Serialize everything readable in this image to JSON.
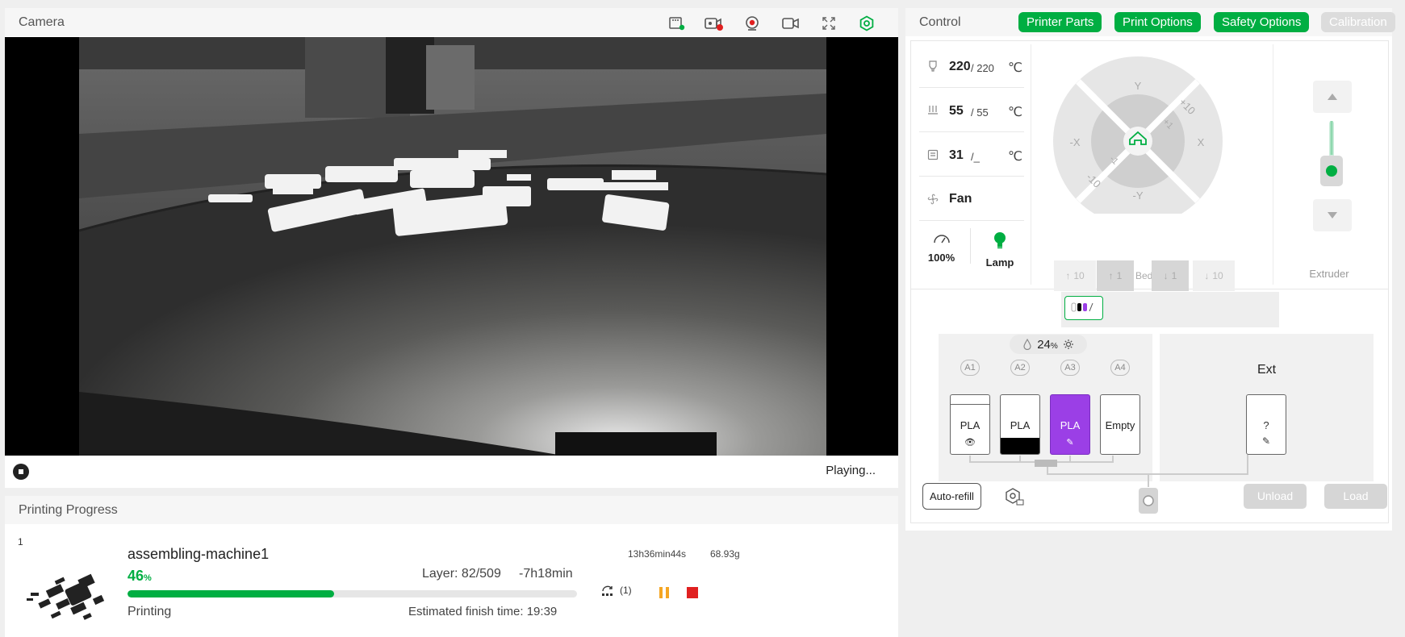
{
  "camera": {
    "title": "Camera",
    "status": "Playing...",
    "icons": [
      "sd-card-icon",
      "record-video-icon",
      "timelapse-icon",
      "camera-switch-icon",
      "fullscreen-icon",
      "settings-icon"
    ]
  },
  "progress": {
    "title": "Printing Progress",
    "job_number": "1",
    "job_name": "assembling-machine1",
    "percent": "46",
    "percent_unit": "%",
    "percent_value": 46,
    "layer": "Layer: 82/509",
    "remaining": "-7h18min",
    "status": "Printing",
    "finish_time": "Estimated finish time: 19:39",
    "duration": "13h36min44s",
    "weight": "68.93g",
    "skip_count": "(1)"
  },
  "control": {
    "title": "Control",
    "tabs": [
      {
        "label": "Printer Parts",
        "enabled": true
      },
      {
        "label": "Print Options",
        "enabled": true
      },
      {
        "label": "Safety Options",
        "enabled": true
      },
      {
        "label": "Calibration",
        "enabled": false
      }
    ],
    "nozzle": {
      "current": "220",
      "target": "/ 220",
      "unit": "℃"
    },
    "bed": {
      "current": "55",
      "target": "/ 55",
      "unit": "℃"
    },
    "chamber": {
      "current": "31",
      "target": "/_",
      "unit": "℃"
    },
    "fan_label": "Fan",
    "speed": "100%",
    "lamp": "Lamp",
    "jog": {
      "y": "Y",
      "neg_y": "-Y",
      "x": "X",
      "neg_x": "-X",
      "plus10": "+10",
      "plus1": "+1",
      "minus1": "-1",
      "minus10": "-10"
    },
    "bed_controls": {
      "up10": "10",
      "up1": "1",
      "label": "Bed",
      "down1": "1",
      "down10": "10"
    },
    "extruder_label": "Extruder"
  },
  "ams": {
    "humidity": "24",
    "humidity_unit": "%",
    "slots": [
      {
        "id": "A1",
        "material": "PLA",
        "sub": "👁"
      },
      {
        "id": "A2",
        "material": "PLA",
        "sub": ""
      },
      {
        "id": "A3",
        "material": "PLA",
        "sub": "✎"
      },
      {
        "id": "A4",
        "material": "Empty",
        "sub": ""
      }
    ],
    "ext_title": "Ext",
    "ext_material": "?",
    "ext_sub": "✎",
    "auto_refill": "Auto-refill",
    "unload": "Unload",
    "load": "Load",
    "colors": {
      "accent": "#00ae42",
      "slot3": "#9b3fe6"
    }
  }
}
